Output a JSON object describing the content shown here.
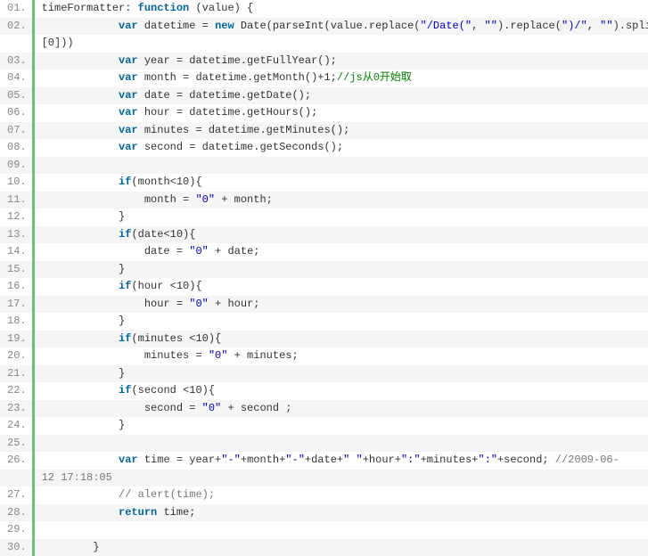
{
  "gutter": [
    "01.",
    "02.",
    "",
    "03.",
    "04.",
    "05.",
    "06.",
    "07.",
    "08.",
    "09.",
    "10.",
    "11.",
    "12.",
    "13.",
    "14.",
    "15.",
    "16.",
    "17.",
    "18.",
    "19.",
    "20.",
    "21.",
    "22.",
    "23.",
    "24.",
    "25.",
    "26.",
    "",
    "27.",
    "28.",
    "29.",
    "30."
  ],
  "lines": [
    [
      [
        "p",
        "timeFormatter: "
      ],
      [
        "k",
        "function"
      ],
      [
        "p",
        " (value) {"
      ]
    ],
    [
      [
        "p",
        "            "
      ],
      [
        "k",
        "var"
      ],
      [
        "p",
        " datetime = "
      ],
      [
        "k",
        "new"
      ],
      [
        "p",
        " Date(parseInt(value.replace("
      ],
      [
        "s",
        "\"/Date(\""
      ],
      [
        "p",
        ", "
      ],
      [
        "s",
        "\"\""
      ],
      [
        "p",
        ").replace("
      ],
      [
        "s",
        "\")/\""
      ],
      [
        "p",
        ", "
      ],
      [
        "s",
        "\"\""
      ],
      [
        "p",
        ").split"
      ]
    ],
    [
      [
        "p",
        "[0]))"
      ]
    ],
    [
      [
        "p",
        "            "
      ],
      [
        "k",
        "var"
      ],
      [
        "p",
        " year = datetime.getFullYear();"
      ]
    ],
    [
      [
        "p",
        "            "
      ],
      [
        "k",
        "var"
      ],
      [
        "p",
        " month = datetime.getMonth()+1;"
      ],
      [
        "g",
        "//js从0开始取"
      ]
    ],
    [
      [
        "p",
        "            "
      ],
      [
        "k",
        "var"
      ],
      [
        "p",
        " date = datetime.getDate();"
      ]
    ],
    [
      [
        "p",
        "            "
      ],
      [
        "k",
        "var"
      ],
      [
        "p",
        " hour = datetime.getHours();"
      ]
    ],
    [
      [
        "p",
        "            "
      ],
      [
        "k",
        "var"
      ],
      [
        "p",
        " minutes = datetime.getMinutes();"
      ]
    ],
    [
      [
        "p",
        "            "
      ],
      [
        "k",
        "var"
      ],
      [
        "p",
        " second = datetime.getSeconds();"
      ]
    ],
    [
      [
        "p",
        " "
      ]
    ],
    [
      [
        "p",
        "            "
      ],
      [
        "k",
        "if"
      ],
      [
        "p",
        "(month<10){"
      ]
    ],
    [
      [
        "p",
        "                month = "
      ],
      [
        "s",
        "\"0\""
      ],
      [
        "p",
        " + month;"
      ]
    ],
    [
      [
        "p",
        "            }"
      ]
    ],
    [
      [
        "p",
        "            "
      ],
      [
        "k",
        "if"
      ],
      [
        "p",
        "(date<10){"
      ]
    ],
    [
      [
        "p",
        "                date = "
      ],
      [
        "s",
        "\"0\""
      ],
      [
        "p",
        " + date;"
      ]
    ],
    [
      [
        "p",
        "            }"
      ]
    ],
    [
      [
        "p",
        "            "
      ],
      [
        "k",
        "if"
      ],
      [
        "p",
        "(hour <10){"
      ]
    ],
    [
      [
        "p",
        "                hour = "
      ],
      [
        "s",
        "\"0\""
      ],
      [
        "p",
        " + hour;"
      ]
    ],
    [
      [
        "p",
        "            }"
      ]
    ],
    [
      [
        "p",
        "            "
      ],
      [
        "k",
        "if"
      ],
      [
        "p",
        "(minutes <10){"
      ]
    ],
    [
      [
        "p",
        "                minutes = "
      ],
      [
        "s",
        "\"0\""
      ],
      [
        "p",
        " + minutes;"
      ]
    ],
    [
      [
        "p",
        "            }"
      ]
    ],
    [
      [
        "p",
        "            "
      ],
      [
        "k",
        "if"
      ],
      [
        "p",
        "(second <10){"
      ]
    ],
    [
      [
        "p",
        "                second = "
      ],
      [
        "s",
        "\"0\""
      ],
      [
        "p",
        " + second ;"
      ]
    ],
    [
      [
        "p",
        "            }"
      ]
    ],
    [
      [
        "p",
        " "
      ]
    ],
    [
      [
        "p",
        "            "
      ],
      [
        "k",
        "var"
      ],
      [
        "p",
        " time = year+"
      ],
      [
        "s",
        "\"-\""
      ],
      [
        "p",
        "+month+"
      ],
      [
        "s",
        "\"-\""
      ],
      [
        "p",
        "+date+"
      ],
      [
        "s",
        "\" \""
      ],
      [
        "p",
        "+hour+"
      ],
      [
        "s",
        "\":\""
      ],
      [
        "p",
        "+minutes+"
      ],
      [
        "s",
        "\":\""
      ],
      [
        "p",
        "+second; "
      ],
      [
        "c",
        "//2009-06-"
      ]
    ],
    [
      [
        "c",
        "12 17:18:05"
      ]
    ],
    [
      [
        "p",
        "            "
      ],
      [
        "c",
        "// alert(time);"
      ]
    ],
    [
      [
        "p",
        "            "
      ],
      [
        "k",
        "return"
      ],
      [
        "p",
        " time;"
      ]
    ],
    [
      [
        "p",
        " "
      ]
    ],
    [
      [
        "p",
        "        }"
      ]
    ]
  ]
}
